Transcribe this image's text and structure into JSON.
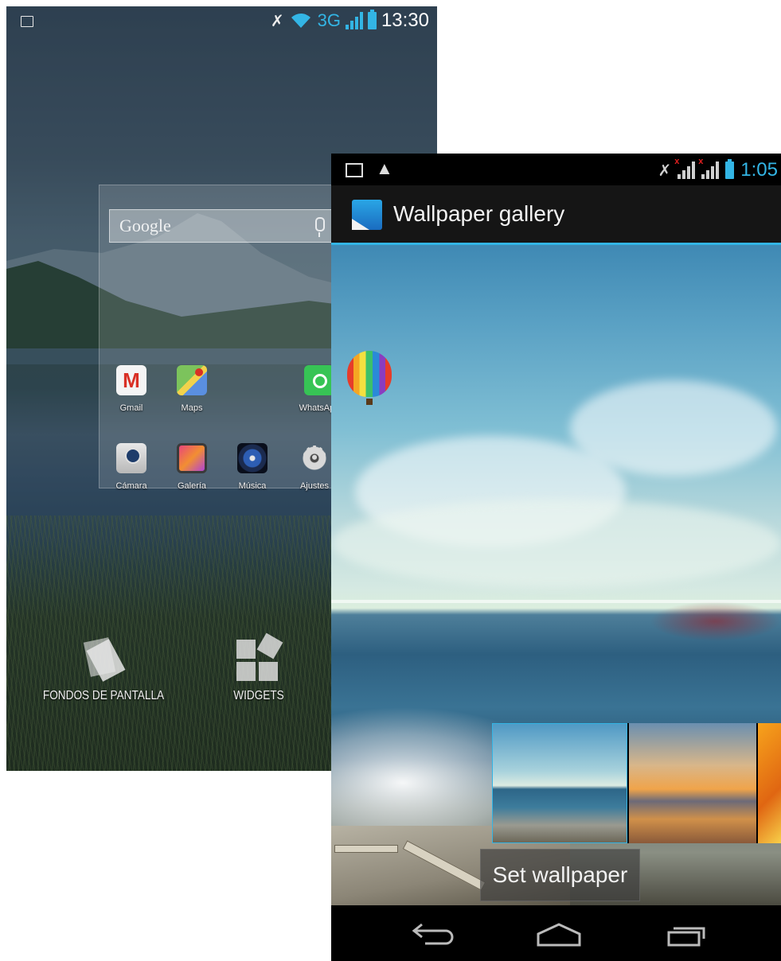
{
  "launcher": {
    "status_bar": {
      "network": "3G",
      "time": "13:30"
    },
    "search": {
      "logo": "Google"
    },
    "apps": [
      {
        "label": "Gmail",
        "icon": "gmail-icon"
      },
      {
        "label": "Maps",
        "icon": "maps-icon"
      },
      {
        "label": "WhatsApp",
        "icon": "whatsapp-icon"
      },
      {
        "label": "Cámara",
        "icon": "camera-icon"
      },
      {
        "label": "Galería",
        "icon": "gallery-icon"
      },
      {
        "label": "Música",
        "icon": "music-icon"
      },
      {
        "label": "Ajustes",
        "icon": "settings-icon"
      }
    ],
    "bottom_options": {
      "wallpapers": "FONDOS DE PANTALLA",
      "widgets": "WIDGETS"
    }
  },
  "gallery": {
    "status_bar": {
      "time": "1:05"
    },
    "action_bar": {
      "title": "Wallpaper gallery"
    },
    "set_wallpaper_label": "Set wallpaper",
    "thumbnails": [
      {
        "name": "sea-balloon",
        "selected": true
      },
      {
        "name": "sunset-lake",
        "selected": false
      },
      {
        "name": "orange",
        "selected": false
      }
    ],
    "accent_color": "#33b5e5"
  }
}
